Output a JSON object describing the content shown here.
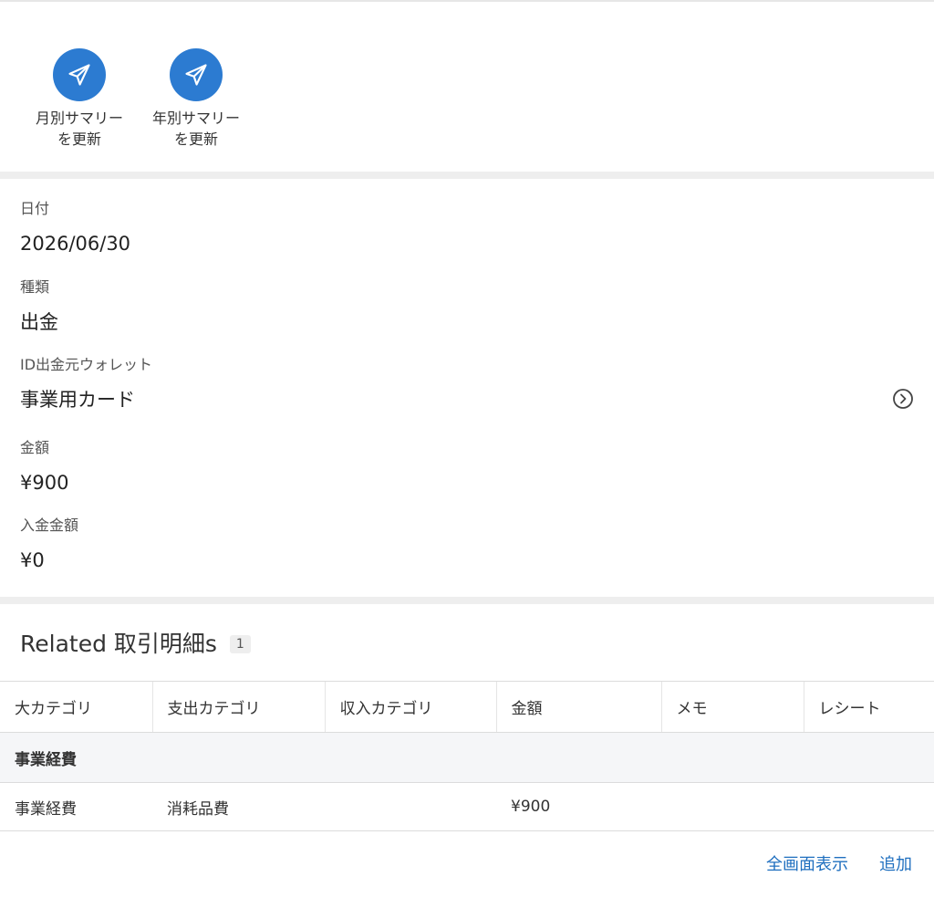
{
  "actions": [
    {
      "label_line1": "月別サマリー",
      "label_line2": "を更新",
      "icon": "paper-plane-icon"
    },
    {
      "label_line1": "年別サマリー",
      "label_line2": "を更新",
      "icon": "paper-plane-icon"
    }
  ],
  "fields": [
    {
      "label": "日付",
      "value": "2026/06/30"
    },
    {
      "label": "種類",
      "value": "出金"
    },
    {
      "label": "ID出金元ウォレット",
      "value": "事業用カード"
    },
    {
      "label": "金額",
      "value": "¥900"
    },
    {
      "label": "入金金額",
      "value": "¥0"
    }
  ],
  "related": {
    "title": "Related 取引明細s",
    "count": "1",
    "columns": [
      "大カテゴリ",
      "支出カテゴリ",
      "収入カテゴリ",
      "金額",
      "メモ",
      "レシート"
    ],
    "group_label": "事業経費",
    "rows": [
      [
        "事業経費",
        "消耗品費",
        "",
        "¥900",
        "",
        ""
      ]
    ],
    "view_all_label": "全画面表示",
    "add_label": "追加"
  },
  "colors": {
    "accent": "#2c7bd1",
    "link": "#1f6fbf"
  }
}
